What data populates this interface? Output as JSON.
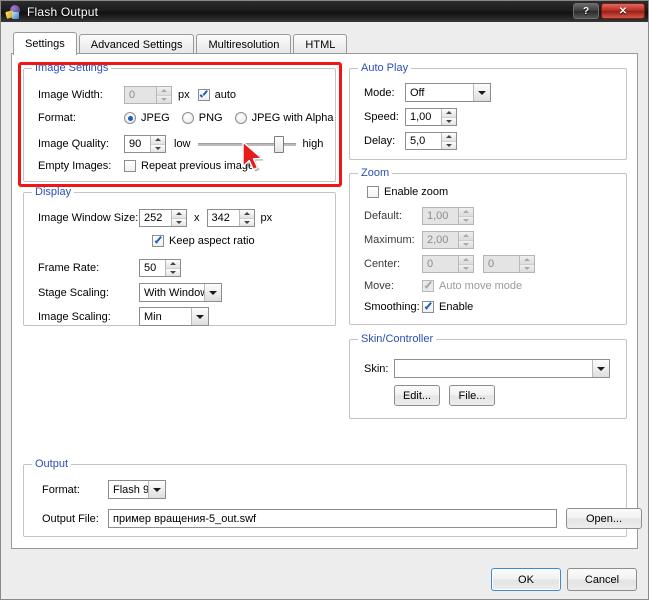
{
  "window": {
    "title": "Flash Output",
    "icon": "flash-app-icon",
    "buttons": {
      "help": "?",
      "close": "✕"
    }
  },
  "tabs": [
    {
      "label": "Settings",
      "active": true
    },
    {
      "label": "Advanced Settings",
      "active": false
    },
    {
      "label": "Multiresolution",
      "active": false
    },
    {
      "label": "HTML",
      "active": false
    }
  ],
  "image_settings": {
    "legend": "Image Settings",
    "highlighted": true,
    "highlight_color": "#f21515",
    "image_width": {
      "label": "Image Width:",
      "value": "0",
      "unit": "px",
      "disabled": true
    },
    "auto": {
      "label": "auto",
      "checked": true
    },
    "format": {
      "label": "Format:",
      "options": [
        "JPEG",
        "PNG",
        "JPEG with Alpha"
      ],
      "selected": "JPEG"
    },
    "image_quality": {
      "label": "Image Quality:",
      "value": "90",
      "low_label": "low",
      "high_label": "high",
      "slider_percent": 78
    },
    "empty_images": {
      "label": "Empty Images:",
      "checkbox_label": "Repeat previous image",
      "checked": false
    }
  },
  "display": {
    "legend": "Display",
    "image_window_size": {
      "label": "Image Window Size:",
      "width": "252",
      "separator": "x",
      "height": "342",
      "unit": "px"
    },
    "keep_aspect_ratio": {
      "label": "Keep aspect ratio",
      "checked": true
    },
    "frame_rate": {
      "label": "Frame Rate:",
      "value": "50"
    },
    "stage_scaling": {
      "label": "Stage Scaling:",
      "value": "With Window"
    },
    "image_scaling": {
      "label": "Image Scaling:",
      "value": "Min"
    }
  },
  "auto_play": {
    "legend": "Auto Play",
    "mode": {
      "label": "Mode:",
      "value": "Off"
    },
    "speed": {
      "label": "Speed:",
      "value": "1,00"
    },
    "delay": {
      "label": "Delay:",
      "value": "5,0"
    }
  },
  "zoom": {
    "legend": "Zoom",
    "enable_zoom": {
      "label": "Enable zoom",
      "checked": false
    },
    "default": {
      "label": "Default:",
      "value": "1,00",
      "disabled": true
    },
    "maximum": {
      "label": "Maximum:",
      "value": "2,00",
      "disabled": true
    },
    "center": {
      "label": "Center:",
      "x": "0",
      "y": "0",
      "disabled": true
    },
    "move": {
      "label": "Move:",
      "checkbox_label": "Auto move mode",
      "checked": true,
      "disabled": true
    },
    "smoothing": {
      "label": "Smoothing:",
      "checkbox_label": "Enable",
      "checked": true
    }
  },
  "skin_controller": {
    "legend": "Skin/Controller",
    "skin": {
      "label": "Skin:",
      "value": ""
    },
    "edit_button": "Edit...",
    "file_button": "File..."
  },
  "output": {
    "legend": "Output",
    "format": {
      "label": "Format:",
      "value": "Flash 9"
    },
    "output_file": {
      "label": "Output File:",
      "value": "пример вращения-5_out.swf"
    },
    "open_button": "Open..."
  },
  "footer": {
    "ok": "OK",
    "cancel": "Cancel"
  }
}
